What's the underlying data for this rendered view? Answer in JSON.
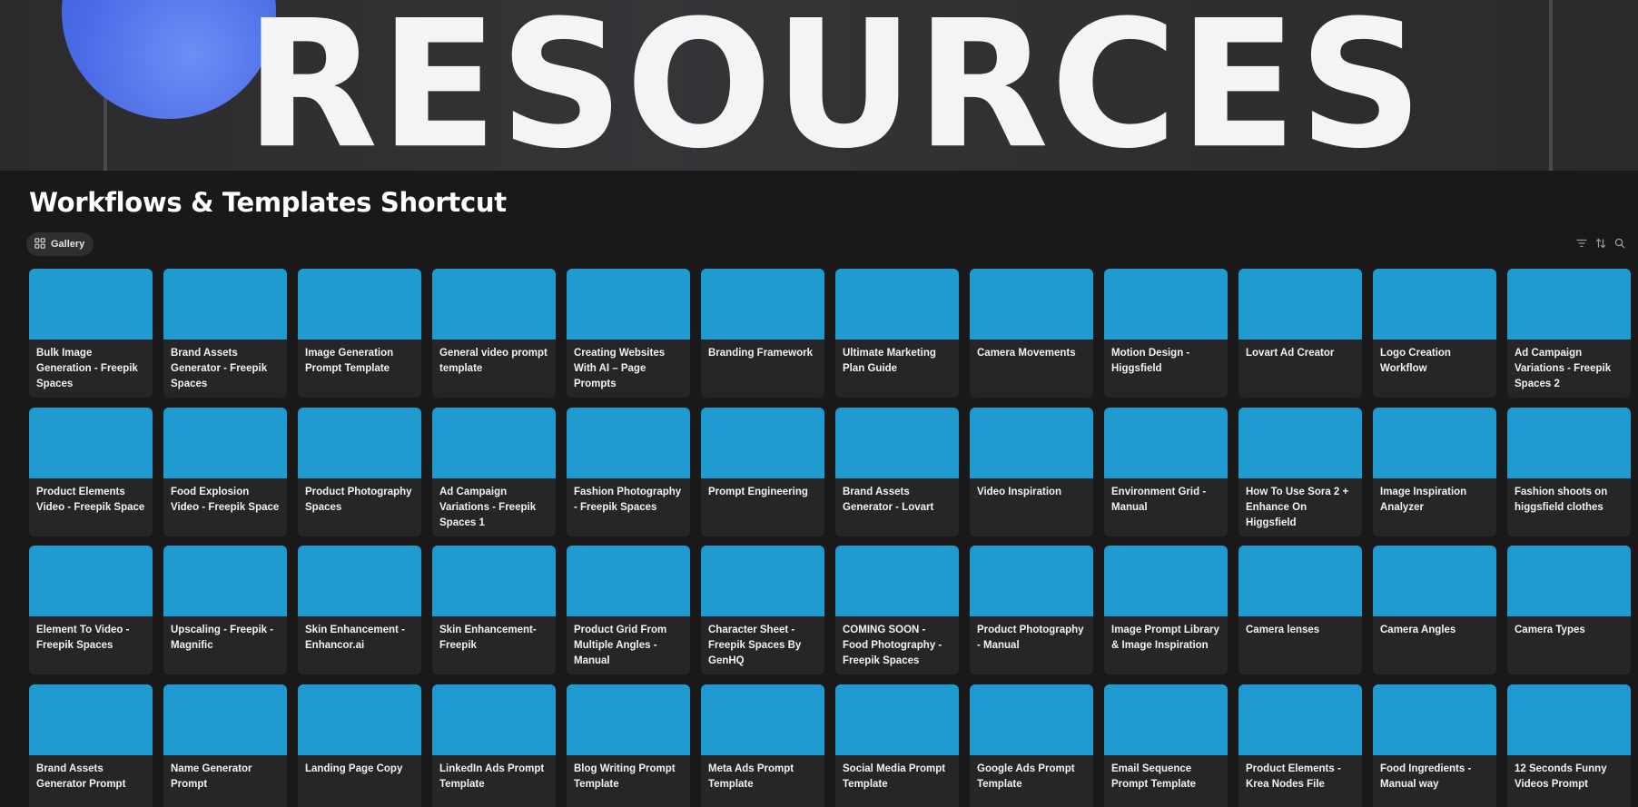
{
  "banner": {
    "word": "RESOURCES",
    "circle_color": "#4a6be6"
  },
  "page": {
    "title": "Workflows & Templates Shortcut"
  },
  "view": {
    "label": "Gallery",
    "icon": "gallery-grid-icon"
  },
  "toolbar": {
    "icons": [
      "filter-icon",
      "sort-icon",
      "search-icon"
    ]
  },
  "colors": {
    "thumbnail": "#1f9bd1",
    "card": "#262626",
    "background": "#191919"
  },
  "cards": [
    "Bulk Image Generation - Freepik Spaces",
    "Brand Assets Generator - Freepik Spaces",
    "Image Generation Prompt Template",
    "General video prompt template",
    "Creating Websites With AI – Page Prompts",
    "Branding Framework",
    "Ultimate Marketing Plan Guide",
    "Camera Movements",
    "Motion Design - Higgsfield",
    "Lovart Ad Creator",
    "Logo Creation Workflow",
    "Ad Campaign Variations - Freepik Spaces 2",
    "Product Elements Video - Freepik Space",
    "Food Explosion Video - Freepik Space",
    "Product Photography Spaces",
    "Ad Campaign Variations - Freepik Spaces 1",
    "Fashion Photography - Freepik Spaces",
    "Prompt Engineering",
    "Brand Assets Generator - Lovart",
    "Video Inspiration",
    "Environment Grid - Manual",
    "How To Use Sora 2 + Enhance On Higgsfield",
    "Image Inspiration Analyzer",
    "Fashion shoots on higgsfield clothes",
    "Element To Video - Freepik Spaces",
    "Upscaling - Freepik - Magnific",
    "Skin Enhancement - Enhancor.ai",
    "Skin Enhancement- Freepik",
    "Product Grid From Multiple Angles - Manual",
    "Character Sheet - Freepik Spaces By GenHQ",
    "COMING SOON - Food Photography - Freepik Spaces",
    "Product Photography - Manual",
    "Image Prompt Library & Image Inspiration",
    "Camera lenses",
    "Camera Angles",
    "Camera Types",
    "Brand Assets Generator Prompt",
    "Name Generator Prompt",
    "Landing Page Copy",
    "LinkedIn Ads Prompt Template",
    "Blog Writing Prompt Template",
    "Meta Ads Prompt Template",
    "Social Media Prompt Template",
    "Google Ads Prompt Template",
    "Email Sequence Prompt Template",
    "Product Elements - Krea Nodes File",
    "Food Ingredients - Manual way",
    "12 Seconds Funny Videos Prompt"
  ]
}
